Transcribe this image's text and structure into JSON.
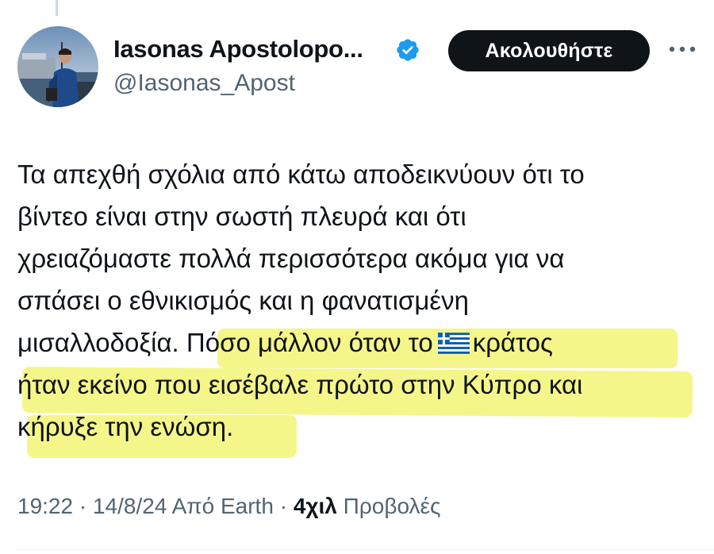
{
  "author": {
    "display_name": "Iasonas Apostolopo...",
    "handle": "@Iasonas_Apost",
    "verified": true,
    "avatar_icon": "profile-photo-man-on-ship-deck"
  },
  "follow_button": {
    "label": "Ακολουθήστε"
  },
  "more_icon": "more-horizontal-icon",
  "tweet": {
    "lines": {
      "l1": "Τα απεχθή σχόλια από κάτω αποδεικνύουν ότι το",
      "l2": "βίντεο είναι στην σωστή πλευρά και ότι",
      "l3": "χρειαζόμαστε πολλά περισσότερα ακόμα για να",
      "l4": "σπάσει ο εθνικισμός και η φανατισμένη",
      "l5_plain": "μισαλλοδοξία.",
      "l5_highlight_a": "Πόσο μάλλον όταν το",
      "l5_highlight_b": "κράτος",
      "l6": "ήταν εκείνο που εισέβαλε πρώτο στην Κύπρο και",
      "l7": "κήρυξε την ενώση."
    },
    "emoji": "greek-flag-icon",
    "highlight_color": "#f4f57a"
  },
  "meta": {
    "time": "19:22",
    "separator": "·",
    "date": "14/8/24",
    "source_prefix": "Από",
    "source": "Earth",
    "views_count": "4χιλ",
    "views_label": "Προβολές"
  },
  "colors": {
    "text": "#0f1419",
    "secondary": "#536471",
    "verified": "#1d9bf0",
    "button_bg": "#0f1419"
  }
}
